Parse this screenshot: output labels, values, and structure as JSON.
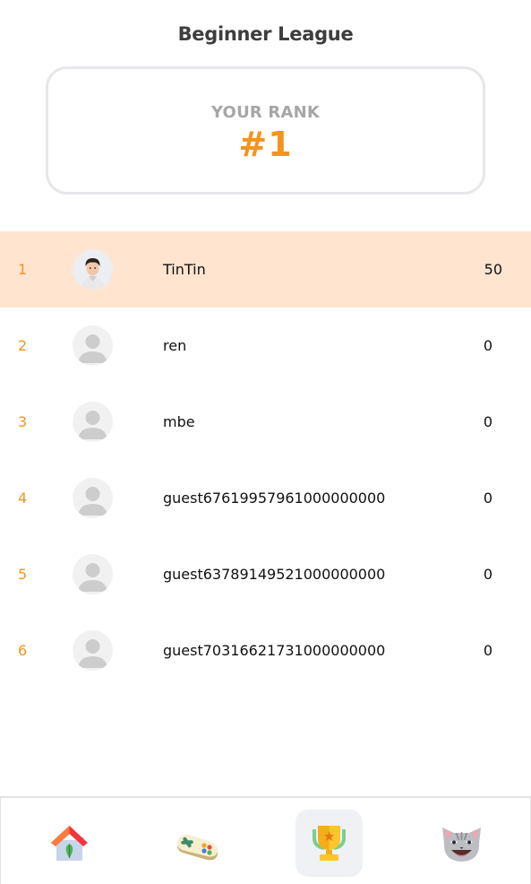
{
  "league": {
    "title": "Beginner League",
    "rank_label": "YOUR RANK",
    "rank_value": "#1"
  },
  "leaderboard": [
    {
      "position": "1",
      "name": "TinTin",
      "score": "50",
      "avatar": "photo-avatar",
      "highlighted": true
    },
    {
      "position": "2",
      "name": "ren",
      "score": "0",
      "avatar": "default-avatar",
      "highlighted": false
    },
    {
      "position": "3",
      "name": "mbe",
      "score": "0",
      "avatar": "default-avatar",
      "highlighted": false
    },
    {
      "position": "4",
      "name": "guest67619957961000000000",
      "score": "0",
      "avatar": "default-avatar",
      "highlighted": false
    },
    {
      "position": "5",
      "name": "guest63789149521000000000",
      "score": "0",
      "avatar": "default-avatar",
      "highlighted": false
    },
    {
      "position": "6",
      "name": "guest70316621731000000000",
      "score": "0",
      "avatar": "default-avatar",
      "highlighted": false
    }
  ],
  "nav": {
    "items": [
      {
        "icon": "home-icon",
        "active": false
      },
      {
        "icon": "gamepad-icon",
        "active": false
      },
      {
        "icon": "trophy-icon",
        "active": true
      },
      {
        "icon": "cat-icon",
        "active": false
      }
    ]
  },
  "colors": {
    "accent": "#f6931d",
    "highlight_row": "#ffe4cf",
    "card_border": "#e6e7ea",
    "nav_active_bg": "#eff1f5"
  }
}
